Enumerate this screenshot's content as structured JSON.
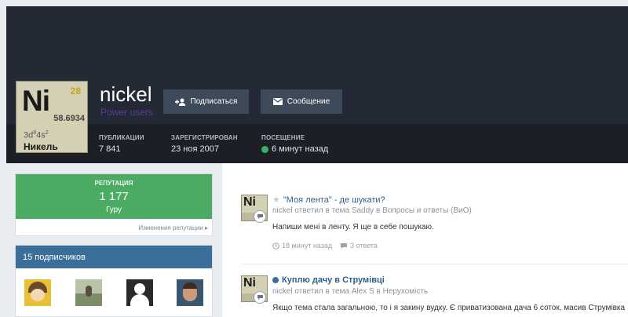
{
  "profile": {
    "avatar": {
      "symbol": "Ni",
      "atomic_number": "28",
      "atomic_mass": "58.6934",
      "element_name": "Никель"
    },
    "username": "nickel",
    "group": "Power users",
    "follow_button": "Подписаться",
    "message_button": "Сообщение",
    "stats": [
      {
        "label": "ПУБЛИКАЦИИ",
        "value": "7 841"
      },
      {
        "label": "ЗАРЕГИСТРИРОВАН",
        "value": "23 ноя 2007"
      },
      {
        "label": "ПОСЕЩЕНИЕ",
        "value": "6 минут назад"
      }
    ]
  },
  "sidebar": {
    "reputation": {
      "label": "РЕПУТАЦИЯ",
      "value": "1 177",
      "rank": "Гуру",
      "changes_link": "Изменения репутации ▸"
    },
    "subscribers": {
      "title": "15 подписчиков"
    }
  },
  "feed": {
    "posts": [
      {
        "title": "\"Моя лента\" - де шукати?",
        "meta_user": "nickel",
        "meta_action": "ответил в тема",
        "meta_other": "Saddy",
        "meta_in": "в",
        "meta_forum": "Вопросы и ответы (ВиО)",
        "excerpt": "Напиши мені в ленту. Я ще в себе пошукаю.",
        "time": "18 минут назад",
        "replies": "3 ответа"
      },
      {
        "title": "Куплю дачу в Струмівці",
        "meta_user": "nickel",
        "meta_action": "ответил в тема",
        "meta_other": "Alex S",
        "meta_in": "в",
        "meta_forum": "Нерухомість",
        "excerpt": "Якщо тема стала загальною, то і я закину вудку. Є приватизована дача 6 соток, масив Струмівка"
      }
    ]
  },
  "colors": {
    "header_bg": "#232a36",
    "statsbar_bg": "#1c1f25",
    "button_bg": "#3c4a59",
    "reputation_green": "#4cab63",
    "subscribers_blue": "#3b6e99",
    "link_blue": "#2f5f8a",
    "online_green": "#3bb26a"
  }
}
